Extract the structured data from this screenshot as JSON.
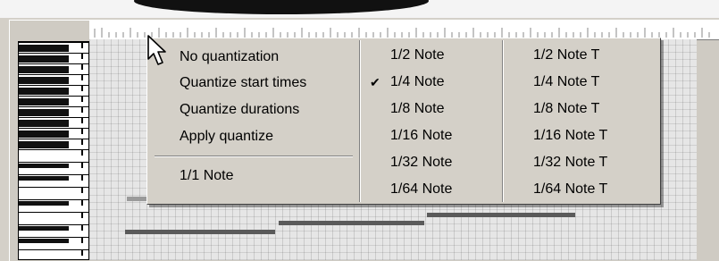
{
  "menu": {
    "quantize_options": [
      "No quantization",
      "Quantize start times",
      "Quantize durations",
      "Apply quantize"
    ],
    "whole_note": "1/1 Note",
    "notes": [
      {
        "label": "1/2 Note",
        "checked": false
      },
      {
        "label": "1/4 Note",
        "checked": true
      },
      {
        "label": "1/8 Note",
        "checked": false
      },
      {
        "label": "1/16 Note",
        "checked": false
      },
      {
        "label": "1/32 Note",
        "checked": false
      },
      {
        "label": "1/64 Note",
        "checked": false
      }
    ],
    "triplets": [
      "1/2 Note T",
      "1/4 Note T",
      "1/8 Note T",
      "1/16 Note T",
      "1/32 Note T",
      "1/64 Note T"
    ],
    "check_glyph": "✔"
  },
  "colors": {
    "menu_background": "#d4d0c8",
    "note_bar": "#5a5a5a",
    "grid_background": "#e6e6e6"
  },
  "icons": {
    "pointer": "mouse-pointer-icon",
    "check": "checkmark-icon"
  }
}
